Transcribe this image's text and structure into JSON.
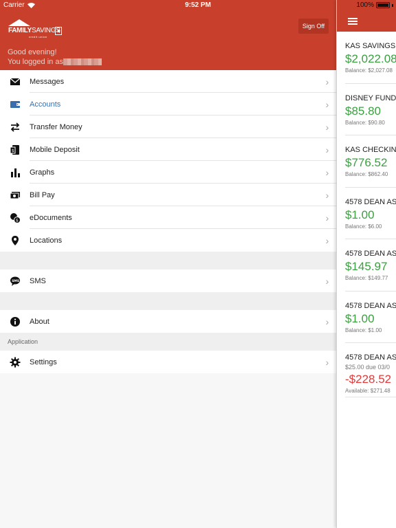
{
  "status": {
    "carrier": "Carrier",
    "time": "9:52 PM",
    "battery": "100%"
  },
  "header": {
    "logo_family": "FAMILY",
    "logo_savings": "SAVINGS",
    "logo_sub": "credit union",
    "signoff_label": "Sign Off",
    "greeting": "Good evening!",
    "logged_in_prefix": "You logged in as"
  },
  "menu": {
    "items": [
      {
        "label": "Messages",
        "icon": "envelope-icon"
      },
      {
        "label": "Accounts",
        "icon": "wallet-icon",
        "active": true
      },
      {
        "label": "Transfer Money",
        "icon": "transfer-arrows-icon"
      },
      {
        "label": "Mobile Deposit",
        "icon": "check-deposit-icon"
      },
      {
        "label": "Graphs",
        "icon": "bar-chart-icon"
      },
      {
        "label": "Bill Pay",
        "icon": "cash-icon"
      },
      {
        "label": "eDocuments",
        "icon": "documents-icon"
      },
      {
        "label": "Locations",
        "icon": "map-pin-icon"
      }
    ],
    "sms": {
      "label": "SMS",
      "icon": "sms-bubble-icon"
    },
    "about": {
      "label": "About",
      "icon": "info-icon"
    },
    "section_application": "Application",
    "settings": {
      "label": "Settings",
      "icon": "gear-icon"
    },
    "chevron": "›"
  },
  "accounts": [
    {
      "name": "KAS SAVINGS",
      "amount": "$2,022.08",
      "balance": "Balance: $2,027.08"
    },
    {
      "name": "DISNEY FUND",
      "amount": "$85.80",
      "balance": "Balance: $90.80"
    },
    {
      "name": "KAS CHECKING",
      "amount": "$776.52",
      "balance": "Balance: $862.40"
    },
    {
      "name": "4578 DEAN AS",
      "amount": "$1.00",
      "balance": "Balance: $6.00"
    },
    {
      "name": "4578 DEAN AS",
      "amount": "$145.97",
      "balance": "Balance: $149.77"
    },
    {
      "name": "4578 DEAN AS",
      "amount": "$1.00",
      "balance": "Balance: $1.00"
    },
    {
      "name": "4578 DEAN AS",
      "due": "$25.00 due 03/0",
      "amount": "-$228.52",
      "balance": "Available: $271.48"
    }
  ],
  "colors": {
    "header_red": "#c8402c",
    "positive_green": "#3aa040",
    "negative_red": "#e23b3b",
    "active_blue": "#3a6fae"
  }
}
